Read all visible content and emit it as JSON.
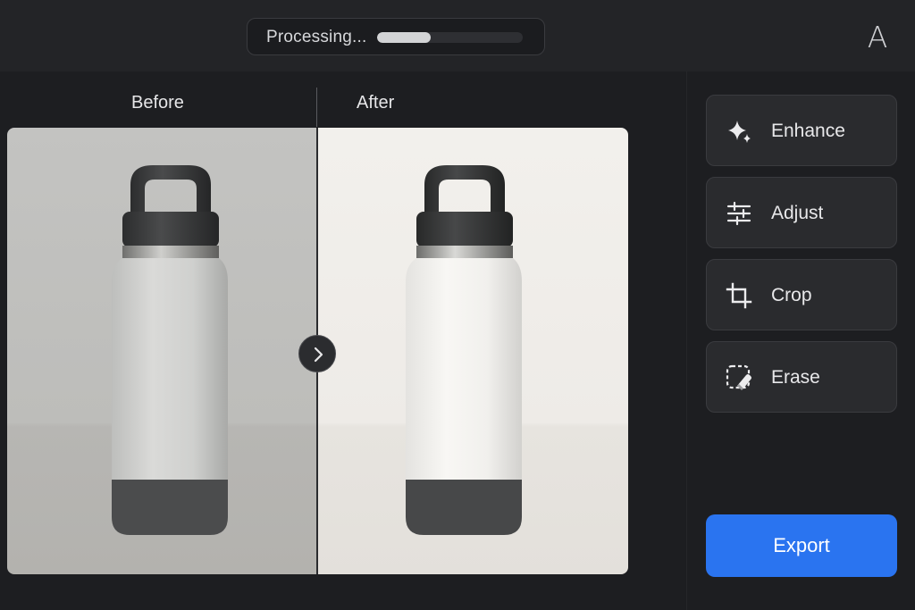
{
  "status": {
    "label": "Processing...",
    "progress": 0.37
  },
  "user": {
    "avatar_letter": "A"
  },
  "compare": {
    "before_label": "Before",
    "after_label": "After"
  },
  "tools": [
    {
      "label": "Enhance",
      "icon": "sparkle-icon"
    },
    {
      "label": "Adjust",
      "icon": "sliders-icon"
    },
    {
      "label": "Crop",
      "icon": "crop-icon"
    },
    {
      "label": "Erase",
      "icon": "eraser-icon"
    }
  ],
  "export": {
    "label": "Export"
  },
  "colors": {
    "accent": "#2a74f0",
    "background": "#1d1e21",
    "panel": "#2a2b2e"
  }
}
